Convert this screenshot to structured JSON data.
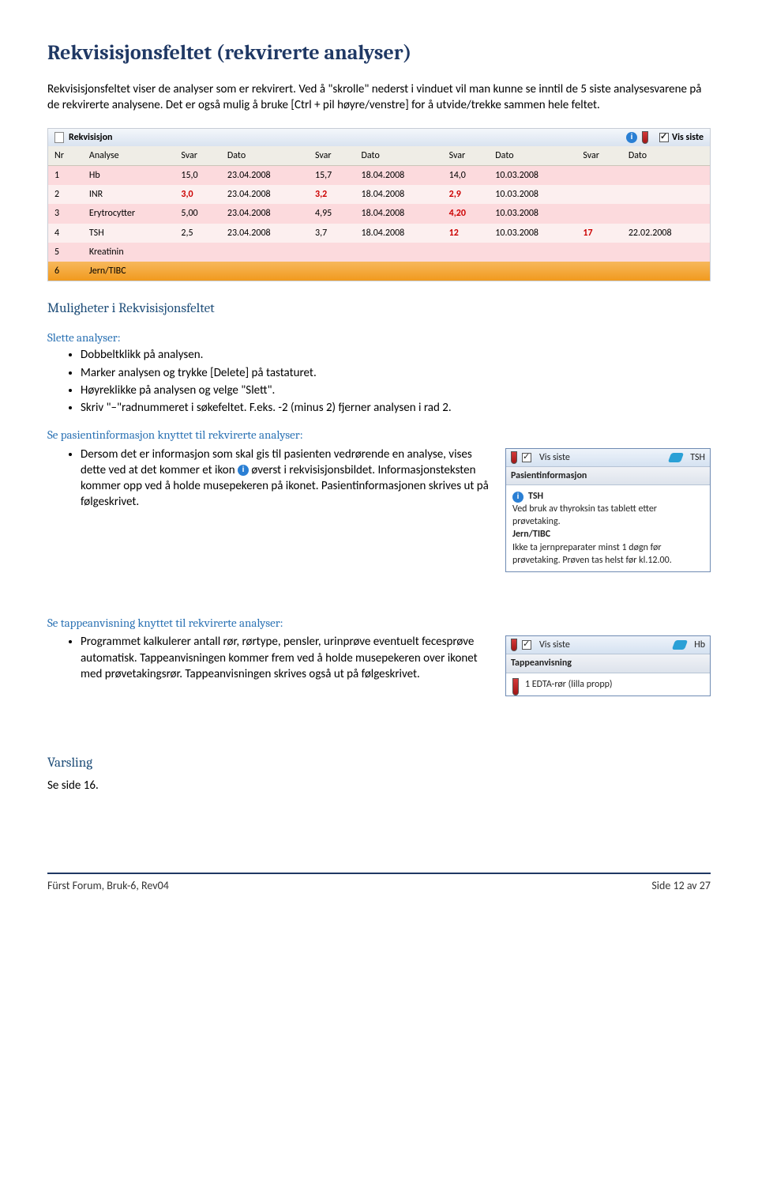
{
  "h1": "Rekvisisjonsfeltet (rekvirerte analyser)",
  "intro": "Rekvisisjonsfeltet viser de analyser som er rekvirert. Ved å \"skrolle\" nederst i vinduet vil man kunne se inntil de 5 siste analysesvarene på de rekvirerte analysene. Det er også mulig å bruke [Ctrl + pil høyre/venstre] for å utvide/trekke sammen hele feltet.",
  "panel": {
    "title": "Rekvisisjon",
    "vis_siste": "Vis siste",
    "headers": [
      "Nr",
      "Analyse",
      "Svar",
      "Dato",
      "Svar",
      "Dato",
      "Svar",
      "Dato",
      "Svar",
      "Dato"
    ],
    "rows": [
      {
        "odd": true,
        "cells": [
          "1",
          "Hb",
          "15,0",
          "23.04.2008",
          "15,7",
          "18.04.2008",
          "14,0",
          "10.03.2008",
          "",
          ""
        ]
      },
      {
        "odd": false,
        "cells": [
          "2",
          "INR",
          "3,0",
          "23.04.2008",
          "3,2",
          "18.04.2008",
          "2,9",
          "10.03.2008",
          "",
          ""
        ],
        "red": [
          2,
          4,
          6
        ]
      },
      {
        "odd": true,
        "cells": [
          "3",
          "Erytrocytter",
          "5,00",
          "23.04.2008",
          "4,95",
          "18.04.2008",
          "4,20",
          "10.03.2008",
          "",
          ""
        ],
        "red": [
          6
        ]
      },
      {
        "odd": false,
        "cells": [
          "4",
          "TSH",
          "2,5",
          "23.04.2008",
          "3,7",
          "18.04.2008",
          "12",
          "10.03.2008",
          "17",
          "22.02.2008"
        ],
        "red": [
          6,
          8
        ]
      },
      {
        "odd": true,
        "cells": [
          "5",
          "Kreatinin",
          "",
          "",
          "",
          "",
          "",
          "",
          "",
          ""
        ]
      },
      {
        "last": true,
        "cells": [
          "6",
          "Jern/TIBC",
          "",
          "",
          "",
          "",
          "",
          "",
          "",
          ""
        ]
      }
    ]
  },
  "h2_mul": "Muligheter i Rekvisisjonsfeltet",
  "slette": {
    "h": "Slette analyser:",
    "b": [
      "Dobbeltklikk på analysen.",
      "Marker analysen og trykke [Delete] på tastaturet.",
      "Høyreklikke på analysen og velge \"Slett\".",
      "Skriv \"–\"radnummeret i søkefeltet. F.eks. -2 (minus 2) fjerner analysen i rad 2."
    ]
  },
  "pasinfo": {
    "h": "Se pasientinformasjon knyttet til rekvirerte analyser:",
    "bullet_pre": "Dersom det er informasjon som skal gis til pasienten vedrørende en analyse, vises dette ved at det kommer et ikon",
    "bullet_post": " øverst i rekvisisjonsbildet. Informasjonsteksten kommer opp ved å holde musepekeren på ikonet. Pasientinformasjonen skrives ut på følgeskrivet.",
    "callout": {
      "vis_siste": "Vis siste",
      "tag": "TSH",
      "title": "Pasientinformasjon",
      "body_title": "TSH",
      "body1": "Ved bruk av thyroksin tas tablett etter prøvetaking.",
      "body_sub": "Jern/TIBC",
      "body2": "Ikke ta jernpreparater minst 1 døgn før prøvetaking. Prøven tas helst før kl.12.00."
    }
  },
  "tappe": {
    "h": "Se tappeanvisning knyttet til rekvirerte analyser:",
    "bullet": "Programmet kalkulerer antall rør, rørtype, pensler, urinprøve eventuelt fecesprøve automatisk. Tappeanvisningen kommer frem ved å holde musepekeren over ikonet med prøvetakingsrør. Tappeanvisningen skrives også ut på følgeskrivet.",
    "callout": {
      "vis_siste": "Vis siste",
      "tag": "Hb",
      "title": "Tappeanvisning",
      "body": "1 EDTA-rør (lilla propp)"
    }
  },
  "varsling": {
    "h": "Varsling",
    "txt": "Se side 16."
  },
  "footer": {
    "left": "Fürst Forum, Bruk-6, Rev04",
    "right": "Side 12 av 27"
  }
}
